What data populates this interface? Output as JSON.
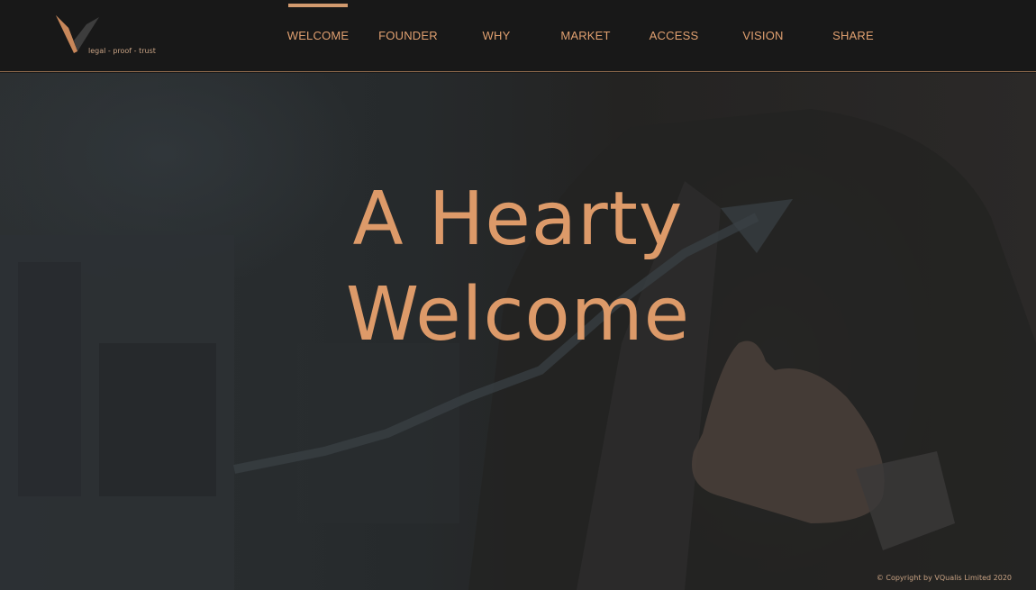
{
  "brand": {
    "tagline": "legal - proof - trust",
    "logo_icon": "v-chevron-logo",
    "accent_color": "#dd9a69",
    "logo_dark_color": "#3c3c3c"
  },
  "nav": {
    "items": [
      {
        "label": "WELCOME",
        "active": true
      },
      {
        "label": "FOUNDER",
        "active": false
      },
      {
        "label": "WHY",
        "active": false
      },
      {
        "label": "MARKET",
        "active": false
      },
      {
        "label": "ACCESS",
        "active": false
      },
      {
        "label": "VISION",
        "active": false
      },
      {
        "label": "SHARE",
        "active": false
      }
    ]
  },
  "hero": {
    "title_line1": "A Hearty",
    "title_line2": "Welcome"
  },
  "footer": {
    "copyright": "© Copyright by VQualis Limited 2020"
  }
}
